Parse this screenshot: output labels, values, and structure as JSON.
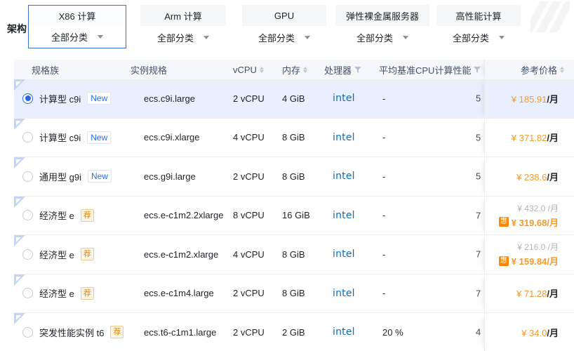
{
  "arch": {
    "label": "架构"
  },
  "tabs": [
    {
      "title": "X86 计算",
      "dropdown": "全部分类",
      "selected": true
    },
    {
      "title": "Arm 计算",
      "dropdown": "全部分类",
      "selected": false
    },
    {
      "title": "GPU",
      "dropdown": "全部分类",
      "selected": false
    },
    {
      "title": "弹性裸金属服务器",
      "dropdown": "全部分类",
      "selected": false
    },
    {
      "title": "高性能计算",
      "dropdown": "全部分类",
      "selected": false
    }
  ],
  "table": {
    "headers": {
      "family": "规格族",
      "spec": "实例规格",
      "vcpu": "vCPU",
      "memory": "内存",
      "processor": "处理器",
      "performance": "平均基准CPU计算性能",
      "price": "参考价格"
    },
    "rows": [
      {
        "family": "计算型 c9i",
        "badge": "New",
        "spec": "ecs.c9i.large",
        "vcpu": "2 vCPU",
        "memory": "4 GiB",
        "processor": "intel",
        "performance": "-",
        "clipped_value": "5",
        "price": "¥ 185.91",
        "price_unit": "/月",
        "selected": true
      },
      {
        "family": "计算型 c9i",
        "badge": "New",
        "spec": "ecs.c9i.xlarge",
        "vcpu": "4 vCPU",
        "memory": "8 GiB",
        "processor": "intel",
        "performance": "-",
        "clipped_value": "5",
        "price": "¥ 371.82",
        "price_unit": "/月",
        "selected": false
      },
      {
        "family": "通用型 g9i",
        "badge": "New",
        "spec": "ecs.g9i.large",
        "vcpu": "2 vCPU",
        "memory": "8 GiB",
        "processor": "intel",
        "performance": "-",
        "clipped_value": "5",
        "price": "¥ 238.6",
        "price_unit": "/月",
        "selected": false
      },
      {
        "family": "经济型 e",
        "badge": "荐",
        "spec": "ecs.e-c1m2.2xlarge",
        "vcpu": "8 vCPU",
        "memory": "16 GiB",
        "processor": "intel",
        "performance": "-",
        "clipped_value": "7",
        "original_price": "¥ 432.0 /月",
        "promo_badge": "惠",
        "price": "¥ 319.68",
        "price_unit": "/月",
        "selected": false
      },
      {
        "family": "经济型 e",
        "badge": "荐",
        "spec": "ecs.e-c1m2.xlarge",
        "vcpu": "4 vCPU",
        "memory": "8 GiB",
        "processor": "intel",
        "performance": "-",
        "clipped_value": "7",
        "original_price": "¥ 216.0 /月",
        "promo_badge": "惠",
        "price": "¥ 159.84",
        "price_unit": "/月",
        "selected": false
      },
      {
        "family": "经济型 e",
        "badge": "荐",
        "spec": "ecs.e-c1m4.large",
        "vcpu": "2 vCPU",
        "memory": "8 GiB",
        "processor": "intel",
        "performance": "-",
        "clipped_value": "7",
        "price": "¥ 71.28",
        "price_unit": "/月",
        "selected": false
      },
      {
        "family": "突发性能实例 t6",
        "badge": "荐",
        "spec": "ecs.t6-c1m1.large",
        "vcpu": "2 vCPU",
        "memory": "2 GiB",
        "processor": "intel",
        "performance": "20 %",
        "clipped_value": "4",
        "price": "¥ 34.0",
        "price_unit": "/月",
        "selected": false
      }
    ]
  },
  "colors": {
    "accent_blue": "#2b6de9",
    "price_orange": "#f39a2d",
    "intel_blue": "#0b6db8",
    "selected_row_bg": "#e9effc",
    "promo_badge_orange": "#ff8800"
  }
}
